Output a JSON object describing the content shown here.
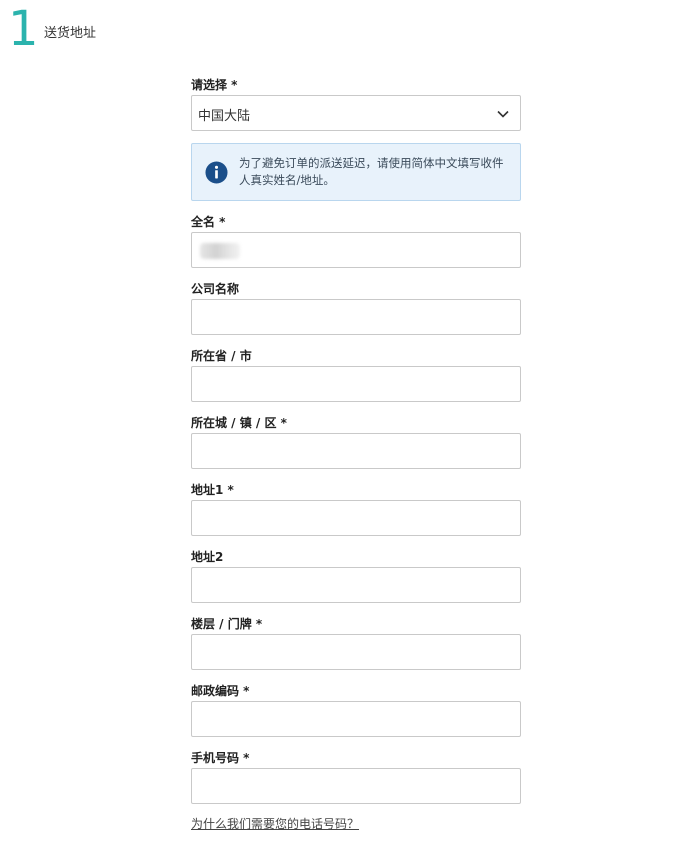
{
  "step": {
    "number": "1",
    "title": "送货地址",
    "accent_color": "#2bb3ad"
  },
  "country": {
    "label": "请选择 *",
    "value": "中国大陆",
    "icon": "chevron-down-icon"
  },
  "notice": {
    "icon": "info-icon",
    "text": "为了避免订单的派送延迟，请使用简体中文填写收件人真实姓名/地址。",
    "background": "#e8f2fb"
  },
  "fields": {
    "full_name": {
      "label": "全名 *",
      "value": ""
    },
    "company": {
      "label": "公司名称",
      "value": ""
    },
    "province": {
      "label": "所在省 / 市",
      "value": ""
    },
    "city": {
      "label": "所在城 / 镇 / 区 *",
      "value": ""
    },
    "address1": {
      "label": "地址1 *",
      "value": ""
    },
    "address2": {
      "label": "地址2",
      "value": ""
    },
    "floor": {
      "label": "楼层 / 门牌 *",
      "value": ""
    },
    "postcode": {
      "label": "邮政编码 *",
      "value": ""
    },
    "phone": {
      "label": "手机号码 *",
      "value": ""
    }
  },
  "phone_help_link": "为什么我们需要您的电话号码？"
}
